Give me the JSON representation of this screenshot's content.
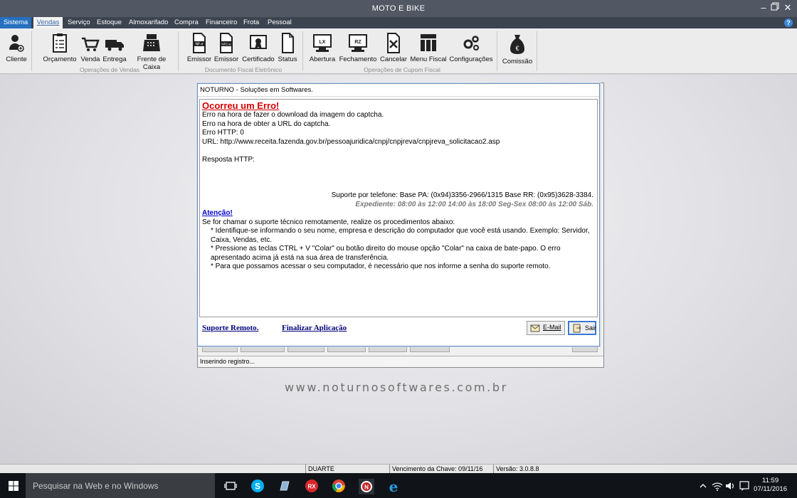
{
  "window": {
    "title": "MOTO E BIKE"
  },
  "menu": {
    "items": [
      "Sistema",
      "Vendas",
      "Serviço",
      "Estoque",
      "Almoxarifado",
      "Compra",
      "Financeiro",
      "Frota",
      "Pessoal"
    ],
    "active": "Vendas",
    "help": "?"
  },
  "ribbon": {
    "cliente": "Cliente",
    "vendas_group": {
      "label": "Operações de Vendas",
      "buttons": [
        "Orçamento",
        "Venda",
        "Entrega",
        "Frente de Caixa"
      ]
    },
    "fiscal_group": {
      "label": "Documento Fiscal Eletrônico",
      "buttons": [
        "Emissor",
        "Emissor",
        "Certificado",
        "Status"
      ],
      "icon_tags": [
        "NF-e",
        "NFC-e"
      ]
    },
    "cupom_group": {
      "label": "Operações de Cupom Fiscal",
      "buttons": [
        "Abertura",
        "Fechamento",
        "Cancelar",
        "Menu Fiscal",
        "Configurações"
      ],
      "icon_tags": [
        "LX",
        "RZ"
      ]
    },
    "comissao": "Comissão"
  },
  "dialog": {
    "title": "NOTURNO - Soluções em Softwares.",
    "error_heading": "Ocorreu um Erro!",
    "lines": [
      "Erro na hora de fazer o download da imagem do captcha.",
      "Erro na hora de obter a URL do captcha.",
      "Erro HTTP: 0",
      "URL: http://www.receita.fazenda.gov.br/pessoajuridica/cnpj/cnpjreva/cnpjreva_solicitacao2.asp"
    ],
    "response_label": "Resposta HTTP:",
    "support_phone": "Suporte por telefone: Base PA: (0x94)3356-2966/1315 Base RR: (0x95)3628-3384.",
    "expediente": "Expediente: 08:00 às 12:00 14:00 às 18:00 Seg-Sex 08:00 às 12:00 Sáb.",
    "attention_heading": "Atenção!",
    "attention_intro": "Se for chamar o suporte técnico remotamente, realize os procedimentos abaixo:",
    "attention_items": [
      "* Identifique-se informando o seu nome, empresa e descrição do computador que você está usando. Exemplo: Servidor, Caixa, Vendas, etc.",
      "* Pressione as teclas CTRL + V \"Colar\" ou botão direito do mouse opção \"Colar\" na caixa de bate-papo. O erro apresentado acima já está na sua área de transferência.",
      "* Para que possamos acessar o seu computador, é necessário que nos informe a senha do suporte remoto."
    ],
    "link_remote": "Suporte Remoto.",
    "link_finalize": "Finalizar Aplicação",
    "email_button": "E-Mail",
    "exit_button": "Sair"
  },
  "back_window": {
    "status": "Inserindo registro..."
  },
  "watermark": "www.noturnosoftwares.com.br",
  "statusbar": {
    "user": "DUARTE",
    "expiry": "Vencimento da Chave: 09/11/16",
    "version": "Versão: 3.0.8.8"
  },
  "taskbar": {
    "search_placeholder": "Pesquisar na Web e no Windows",
    "time": "11:59",
    "date": "07/11/2016",
    "rx_badge": "RX"
  },
  "colors": {
    "titlebar": "#515763",
    "menubar": "#3c4450",
    "error_red": "#d40000",
    "link_blue": "#00007a",
    "selected_border": "#3a7bd5"
  }
}
